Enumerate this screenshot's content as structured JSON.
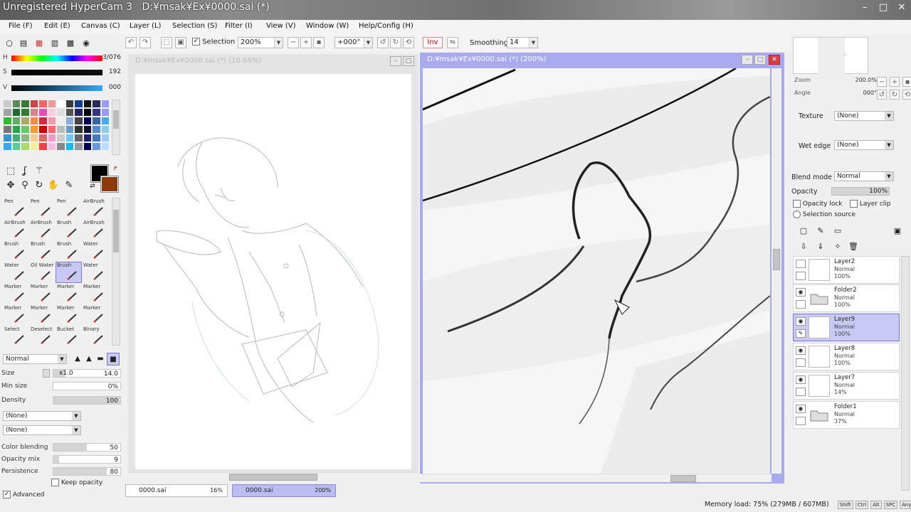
{
  "window": {
    "title": "Unregistered HyperCam 3",
    "title_suffix": "D:¥msak¥Ex¥0000.sai (*)",
    "controls": {
      "minimize": "–",
      "maximize": "□",
      "close": "✕"
    }
  },
  "menu": [
    {
      "label": "File (F)"
    },
    {
      "label": "Edit (E)"
    },
    {
      "label": "Canvas (C)"
    },
    {
      "label": "Layer (L)"
    },
    {
      "label": "Selection (S)"
    },
    {
      "label": "Filter (I)"
    },
    {
      "label": "View (V)"
    },
    {
      "label": "Window (W)"
    },
    {
      "label": "Help/Config (H)"
    }
  ],
  "toolbar": {
    "selection_label": "Selection",
    "selection_checked": true,
    "zoom_value": "200%",
    "angle_value": "+000°",
    "inv_label": "Inv",
    "smoothing_label": "Smoothing",
    "smoothing_value": "14"
  },
  "color": {
    "hue_label": "H",
    "hue_value": "3/076",
    "sat_label": "S",
    "sat_value": "192",
    "val_label": "V",
    "val_value": "000",
    "foreground": "#000000",
    "background": "#8b3a08",
    "swatches": [
      "#c9c9c9",
      "#5a8a5a",
      "#3b7a3b",
      "#c44",
      "#e66",
      "#e99",
      "#fff",
      "#3a3a3a",
      "#1a3a8a",
      "#111",
      "#2a2a5a",
      "#9a9aff",
      "#a4a4a4",
      "#1c6d2e",
      "#2f7d2f",
      "#c88",
      "#f4b",
      "#fcd",
      "#ddd",
      "#555",
      "#226",
      "#000",
      "#338",
      "#99f",
      "#3b3",
      "#6a6",
      "#aa6",
      "#f84",
      "#d24",
      "#f9a",
      "#eee",
      "#8ad",
      "#444",
      "#005",
      "#36a",
      "#4af",
      "#777",
      "#2a4",
      "#6c6",
      "#f93",
      "#c00",
      "#f66",
      "#bbb",
      "#69c",
      "#333",
      "#113",
      "#58c",
      "#8ce",
      "#39c",
      "#4a7",
      "#8b8",
      "#fc8",
      "#d66",
      "#f9c",
      "#ccc",
      "#6cf",
      "#666",
      "#226",
      "#47b",
      "#9cf",
      "#3ae",
      "#5c9",
      "#ad6",
      "#fe9",
      "#e44",
      "#fbd",
      "#888",
      "#1bf",
      "#999",
      "#005",
      "#69d",
      "#bdf"
    ]
  },
  "tools": {
    "selection_icons": [
      "marquee-icon",
      "lasso-icon",
      "magic-wand-icon"
    ],
    "nav_icons": [
      "move-icon",
      "zoom-icon",
      "rotate-icon",
      "hand-icon",
      "eyedropper-icon"
    ]
  },
  "brushes": [
    {
      "label": "Pen"
    },
    {
      "label": "Pen"
    },
    {
      "label": "Pen"
    },
    {
      "label": "AirBrush"
    },
    {
      "label": "AirBrush"
    },
    {
      "label": "AirBrush"
    },
    {
      "label": "Brush"
    },
    {
      "label": "AirBrush"
    },
    {
      "label": "Brush"
    },
    {
      "label": "Brush"
    },
    {
      "label": "Brush"
    },
    {
      "label": "Water"
    },
    {
      "label": "Water"
    },
    {
      "label": "Oil Water"
    },
    {
      "label": "Brush"
    },
    {
      "label": "Water"
    },
    {
      "label": "Marker"
    },
    {
      "label": "Marker"
    },
    {
      "label": "Marker"
    },
    {
      "label": "Marker"
    },
    {
      "label": "Marker"
    },
    {
      "label": "Marker"
    },
    {
      "label": "Marker"
    },
    {
      "label": "Marker"
    },
    {
      "label": "Select"
    },
    {
      "label": "Deselect"
    },
    {
      "label": "Bucket"
    },
    {
      "label": "Binary"
    }
  ],
  "brush_props": {
    "mode": "Normal",
    "size_label": "Size",
    "size_mult": "x1.0",
    "size_value": "14.0",
    "minsize_label": "Min size",
    "minsize_value": "0%",
    "density_label": "Density",
    "density_value": "100",
    "texture1": "(None)",
    "texture2": "(None)",
    "color_blending_label": "Color blending",
    "color_blending_value": "50",
    "opacity_mix_label": "Opacity mix",
    "opacity_mix_value": "9",
    "persistence_label": "Persistence",
    "persistence_value": "80",
    "keep_opacity_label": "Keep opacity",
    "advanced_label": "Advanced"
  },
  "canvas_left": {
    "title": "D:¥msak¥Ex¥0000.sai (*) (16.66%)"
  },
  "canvas_right": {
    "title": "D:¥msak¥Ex¥0000.sai (*) (200%)"
  },
  "doc_tabs": [
    {
      "name": "0000.sai",
      "zoom": "16%"
    },
    {
      "name": "0000.sai",
      "zoom": "200%"
    }
  ],
  "navigator": {
    "zoom_label": "Zoom",
    "zoom_value": "200.0%",
    "angle_label": "Angle",
    "angle_value": "000°"
  },
  "layer_props": {
    "texture_label": "Texture",
    "texture_value": "(None)",
    "wet_edge_label": "Wet edge",
    "wet_edge_value": "(None)",
    "blend_mode_label": "Blend mode",
    "blend_mode_value": "Normal",
    "opacity_label": "Opacity",
    "opacity_value": "100%",
    "opacity_lock_label": "Opacity lock",
    "layer_clip_label": "Layer clip",
    "selection_source_label": "Selection source"
  },
  "layers": [
    {
      "name": "Layer2",
      "mode": "Normal",
      "opacity": "100%",
      "visible": false,
      "type": "layer"
    },
    {
      "name": "Folder2",
      "mode": "Normal",
      "opacity": "100%",
      "visible": true,
      "type": "folder"
    },
    {
      "name": "Layer9",
      "mode": "Normal",
      "opacity": "100%",
      "visible": true,
      "type": "layer",
      "selected": true
    },
    {
      "name": "Layer8",
      "mode": "Normal",
      "opacity": "100%",
      "visible": true,
      "type": "layer"
    },
    {
      "name": "Layer7",
      "mode": "Normal",
      "opacity": "14%",
      "visible": true,
      "type": "layer"
    },
    {
      "name": "Folder1",
      "mode": "Normal",
      "opacity": "37%",
      "visible": true,
      "type": "folder"
    }
  ],
  "status": {
    "memory": "Memory load: 75% (279MB / 607MB)",
    "keys": [
      "Shift",
      "Ctrl",
      "Alt",
      "SPC",
      "Any"
    ]
  }
}
